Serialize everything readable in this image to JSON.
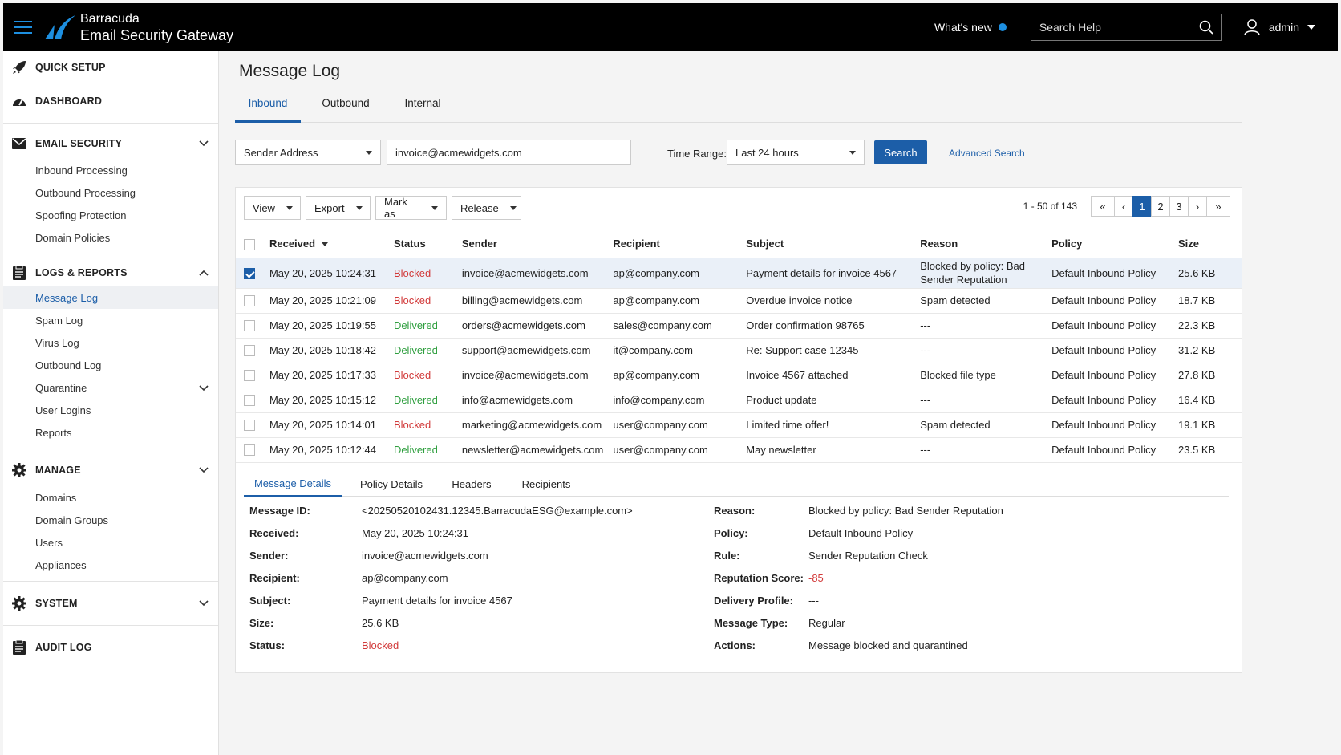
{
  "app": {
    "brand_line1": "Barracuda",
    "brand_line2": "Email Security Gateway",
    "whats_new": "What's new",
    "search_placeholder": "Search Help",
    "user": "admin"
  },
  "sidebar": {
    "quick_setup": "QUICK SETUP",
    "dashboard": "DASHBOARD",
    "email_security": "EMAIL SECURITY",
    "email_items": [
      "Inbound Processing",
      "Outbound Processing",
      "Spoofing Protection",
      "Domain Policies"
    ],
    "logs_reports": "LOGS & REPORTS",
    "logs_items": [
      "Message Log",
      "Spam Log",
      "Virus Log",
      "Outbound Log",
      "Quarantine",
      "User Logins",
      "Reports"
    ],
    "manage": "MANAGE",
    "manage_items": [
      "Domains",
      "Domain Groups",
      "Users",
      "Appliances"
    ],
    "system": "SYSTEM",
    "audit_log": "AUDIT LOG"
  },
  "main": {
    "title": "Message Log",
    "tabs": [
      "Inbound",
      "Outbound",
      "Internal"
    ],
    "filter_field": "Sender Address",
    "filter_value": "invoice@acmewidgets.com",
    "time_range_label": "Time Range:",
    "time_range": "Last 24 hours",
    "search_btn": "Search",
    "advanced_search": "Advanced Search"
  },
  "toolbar": {
    "view": "View",
    "export": "Export",
    "mark_as": "Mark as",
    "release": "Release",
    "count": "1 - 50 of 143",
    "pages": [
      "1",
      "2",
      "3"
    ]
  },
  "table": {
    "headers": [
      "Received",
      "Status",
      "Sender",
      "Recipient",
      "Subject",
      "Reason",
      "Policy",
      "Size"
    ],
    "rows": [
      {
        "received": "May 20, 2025 10:24:31",
        "status": "Blocked",
        "sender": "invoice@acmewidgets.com",
        "recipient": "ap@company.com",
        "subject": "Payment details for invoice 4567",
        "reason": "Blocked by policy: Bad Sender Reputation",
        "policy": "Default Inbound Policy",
        "size": "25.6 KB"
      },
      {
        "received": "May 20, 2025 10:21:09",
        "status": "Blocked",
        "sender": "billing@acmewidgets.com",
        "recipient": "ap@company.com",
        "subject": "Overdue invoice notice",
        "reason": "Spam detected",
        "policy": "Default Inbound Policy",
        "size": "18.7 KB"
      },
      {
        "received": "May 20, 2025 10:19:55",
        "status": "Delivered",
        "sender": "orders@acmewidgets.com",
        "recipient": "sales@company.com",
        "subject": "Order confirmation 98765",
        "reason": "---",
        "policy": "Default Inbound Policy",
        "size": "22.3 KB"
      },
      {
        "received": "May 20, 2025 10:18:42",
        "status": "Delivered",
        "sender": "support@acmewidgets.com",
        "recipient": "it@company.com",
        "subject": "Re: Support case 12345",
        "reason": "---",
        "policy": "Default Inbound Policy",
        "size": "31.2 KB"
      },
      {
        "received": "May 20, 2025 10:17:33",
        "status": "Blocked",
        "sender": "invoice@acmewidgets.com",
        "recipient": "ap@company.com",
        "subject": "Invoice 4567 attached",
        "reason": "Blocked file type",
        "policy": "Default Inbound Policy",
        "size": "27.8 KB"
      },
      {
        "received": "May 20, 2025 10:15:12",
        "status": "Delivered",
        "sender": "info@acmewidgets.com",
        "recipient": "info@company.com",
        "subject": "Product update",
        "reason": "---",
        "policy": "Default Inbound Policy",
        "size": "16.4 KB"
      },
      {
        "received": "May 20, 2025 10:14:01",
        "status": "Blocked",
        "sender": "marketing@acmewidgets.com",
        "recipient": "user@company.com",
        "subject": "Limited time offer!",
        "reason": "Spam detected",
        "policy": "Default Inbound Policy",
        "size": "19.1 KB"
      },
      {
        "received": "May 20, 2025 10:12:44",
        "status": "Delivered",
        "sender": "newsletter@acmewidgets.com",
        "recipient": "user@company.com",
        "subject": "May newsletter",
        "reason": "---",
        "policy": "Default Inbound Policy",
        "size": "23.5 KB"
      }
    ]
  },
  "details": {
    "tabs": [
      "Message Details",
      "Policy Details",
      "Headers",
      "Recipients"
    ],
    "left": [
      {
        "label": "Message ID:",
        "value": "<20250520102431.12345.BarracudaESG@example.com>"
      },
      {
        "label": "Received:",
        "value": "May 20, 2025 10:24:31"
      },
      {
        "label": "Sender:",
        "value": "invoice@acmewidgets.com"
      },
      {
        "label": "Recipient:",
        "value": "ap@company.com"
      },
      {
        "label": "Subject:",
        "value": "Payment details for invoice 4567"
      },
      {
        "label": "Size:",
        "value": "25.6 KB"
      },
      {
        "label": "Status:",
        "value": "Blocked"
      }
    ],
    "right": [
      {
        "label": "Reason:",
        "value": "Blocked by policy: Bad Sender Reputation"
      },
      {
        "label": "Policy:",
        "value": "Default Inbound Policy"
      },
      {
        "label": "Rule:",
        "value": "Sender Reputation Check"
      },
      {
        "label": "Reputation Score:",
        "value": "-85"
      },
      {
        "label": "Delivery Profile:",
        "value": "---"
      },
      {
        "label": "Message Type:",
        "value": "Regular"
      },
      {
        "label": "Actions:",
        "value": "Message blocked and quarantined"
      }
    ]
  },
  "colors": {
    "accent": "#1c5ea8",
    "blocked": "#d23a3a",
    "delivered": "#2e9e3e",
    "topbar": "#000000"
  }
}
